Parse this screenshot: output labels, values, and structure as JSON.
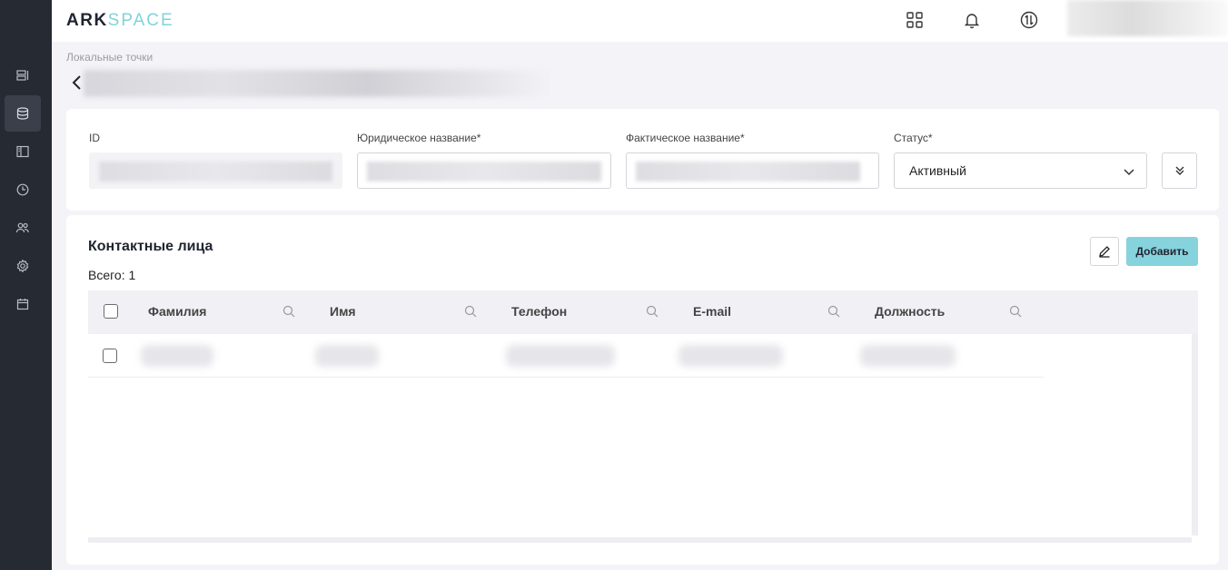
{
  "app": {
    "logo_part1": "ARK",
    "logo_part2": "SPACE"
  },
  "sidebar": {
    "items": [
      {
        "name": "dashboard-icon",
        "active": false
      },
      {
        "name": "database-icon",
        "active": true
      },
      {
        "name": "book-icon",
        "active": false
      },
      {
        "name": "clock-icon",
        "active": false
      },
      {
        "name": "users-icon",
        "active": false
      },
      {
        "name": "gear-icon",
        "active": false
      },
      {
        "name": "calendar-icon",
        "active": false
      }
    ]
  },
  "header": {
    "icons": [
      "apps-grid-icon",
      "bell-icon",
      "sync-icon"
    ]
  },
  "breadcrumb": "Локальные точки",
  "form": {
    "id_label": "ID",
    "legal_name_label": "Юридическое название*",
    "actual_name_label": "Фактическое название*",
    "status_label": "Статус*",
    "status_value": "Активный"
  },
  "contacts": {
    "title": "Контактные лица",
    "total": "Всего: 1",
    "add_label": "Добавить",
    "columns": [
      "Фамилия",
      "Имя",
      "Телефон",
      "E-mail",
      "Должность"
    ]
  },
  "colors": {
    "sidebar_bg": "#262a33",
    "accent": "#86d3dd",
    "logo_accent": "#7fd3dc"
  }
}
